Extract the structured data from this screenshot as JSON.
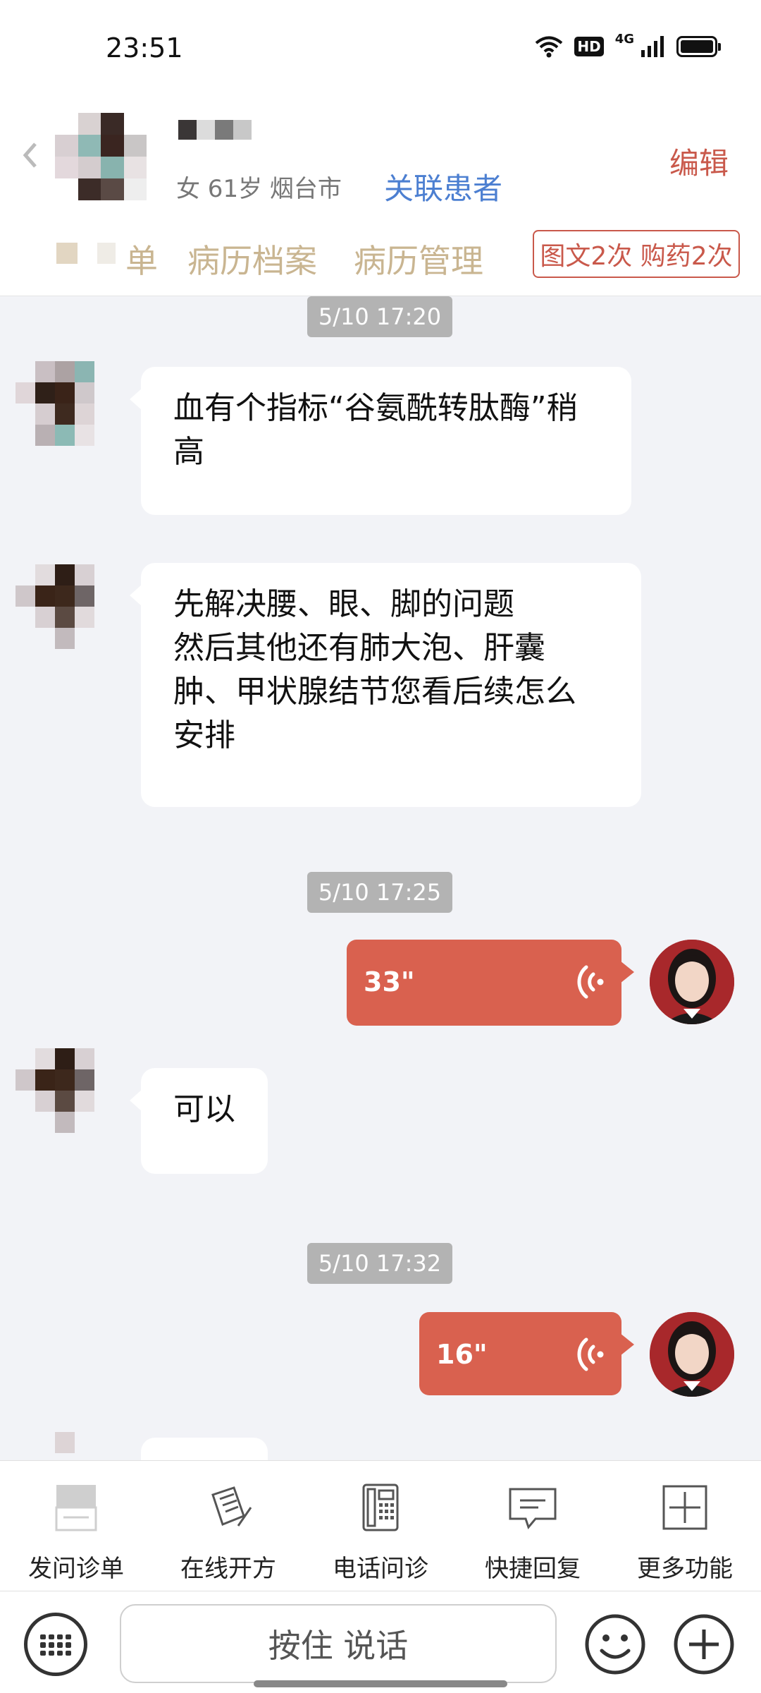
{
  "status_bar": {
    "time": "23:51",
    "hd": "HD",
    "network": "4G"
  },
  "header": {
    "patient_meta": "女 61岁 烟台市",
    "link_patient": "关联患者",
    "edit": "编辑",
    "tabs": [
      {
        "label": "单"
      },
      {
        "label": "病历档案"
      },
      {
        "label": "病历管理"
      }
    ],
    "quota_badge": "图文2次 购药2次"
  },
  "messages": [
    {
      "type": "timestamp",
      "text": "5/10 17:20"
    },
    {
      "type": "incoming",
      "text": "血有个指标“谷氨酰转肽酶”稍高"
    },
    {
      "type": "incoming",
      "lines": [
        "先解决腰、眼、脚的问题",
        "然后其他还有肺大泡、肝囊",
        "肿、甲状腺结节您看后续怎么",
        "安排"
      ]
    },
    {
      "type": "timestamp",
      "text": "5/10 17:25"
    },
    {
      "type": "voice_out",
      "duration": "33\""
    },
    {
      "type": "incoming",
      "text": "可以"
    },
    {
      "type": "timestamp",
      "text": "5/10 17:32"
    },
    {
      "type": "voice_out",
      "duration": "16\""
    }
  ],
  "toolbar": [
    {
      "label": "发问诊单",
      "icon": "inquiry-form-icon"
    },
    {
      "label": "在线开方",
      "icon": "prescription-icon"
    },
    {
      "label": "电话问诊",
      "icon": "phone-icon"
    },
    {
      "label": "快捷回复",
      "icon": "quick-reply-icon"
    },
    {
      "label": "更多功能",
      "icon": "more-plus-icon"
    }
  ],
  "input_bar": {
    "hold_to_talk": "按住 说话"
  },
  "colors": {
    "accent_red": "#d9614f",
    "link_blue": "#4c7fd1",
    "tab_gold": "#c9b591"
  }
}
